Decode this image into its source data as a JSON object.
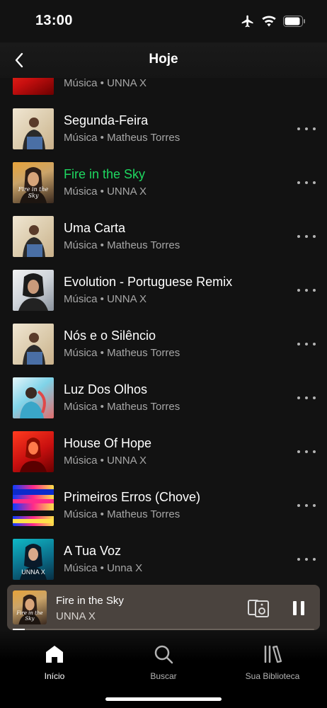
{
  "status": {
    "time": "13:00"
  },
  "header": {
    "title": "Hoje"
  },
  "tracks": [
    {
      "title": "",
      "subtitle": "Música • UNNA X",
      "active": false
    },
    {
      "title": "Segunda-Feira",
      "subtitle": "Música • Matheus Torres",
      "active": false
    },
    {
      "title": "Fire in the Sky",
      "subtitle": "Música • UNNA X",
      "active": true,
      "art_caption": "Fire in the Sky"
    },
    {
      "title": "Uma Carta",
      "subtitle": "Música • Matheus Torres",
      "active": false
    },
    {
      "title": "Evolution - Portuguese Remix",
      "subtitle": "Música • UNNA X",
      "active": false
    },
    {
      "title": "Nós e o Silêncio",
      "subtitle": "Música • Matheus Torres",
      "active": false
    },
    {
      "title": "Luz Dos Olhos",
      "subtitle": "Música • Matheus Torres",
      "active": false
    },
    {
      "title": "House Of Hope",
      "subtitle": "Música • UNNA X",
      "active": false
    },
    {
      "title": "Primeiros Erros (Chove)",
      "subtitle": "Música • Matheus Torres",
      "active": false
    },
    {
      "title": "A Tua Voz",
      "subtitle": "Música • Unna X",
      "active": false,
      "art_caption": "UNNA X"
    }
  ],
  "now_playing": {
    "title": "Fire in the Sky",
    "artist": "UNNA X",
    "art_caption": "Fire in the Sky",
    "progress": 0.04
  },
  "tabs": [
    {
      "label": "Início",
      "icon": "home-icon",
      "active": true
    },
    {
      "label": "Buscar",
      "icon": "search-icon",
      "active": false
    },
    {
      "label": "Sua Biblioteca",
      "icon": "library-icon",
      "active": false
    }
  ],
  "colors": {
    "accent": "#1ed760",
    "background": "#121212",
    "mini_player": "#4a433e"
  }
}
